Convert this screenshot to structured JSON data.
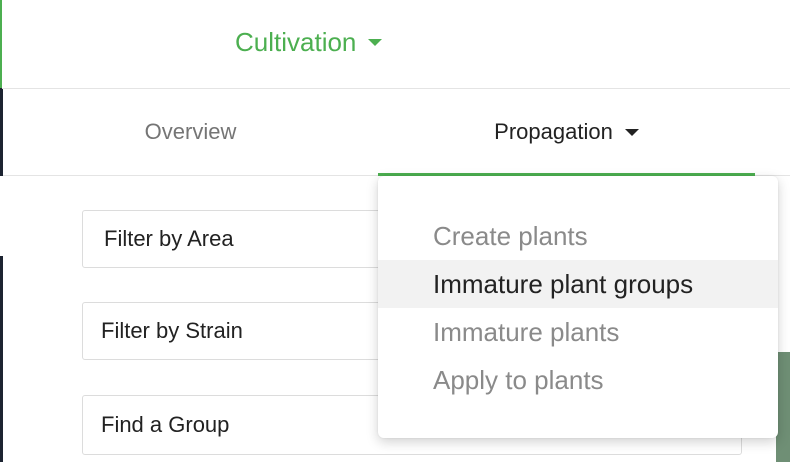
{
  "header": {
    "module_label": "Cultivation",
    "module_icon": "chevron-down-icon",
    "accent_color": "#4caf50"
  },
  "tabs": [
    {
      "label": "Overview"
    },
    {
      "label": "Propagation",
      "icon": "chevron-down-icon"
    }
  ],
  "filters": {
    "area_value": "Filter by Area",
    "strain_value": "Filter by Strain",
    "group_value": "Find a Group"
  },
  "dropdown": {
    "items": [
      {
        "label": "Create plants"
      },
      {
        "label": "Immature plant groups"
      },
      {
        "label": "Immature plants"
      },
      {
        "label": "Apply to plants"
      }
    ]
  }
}
